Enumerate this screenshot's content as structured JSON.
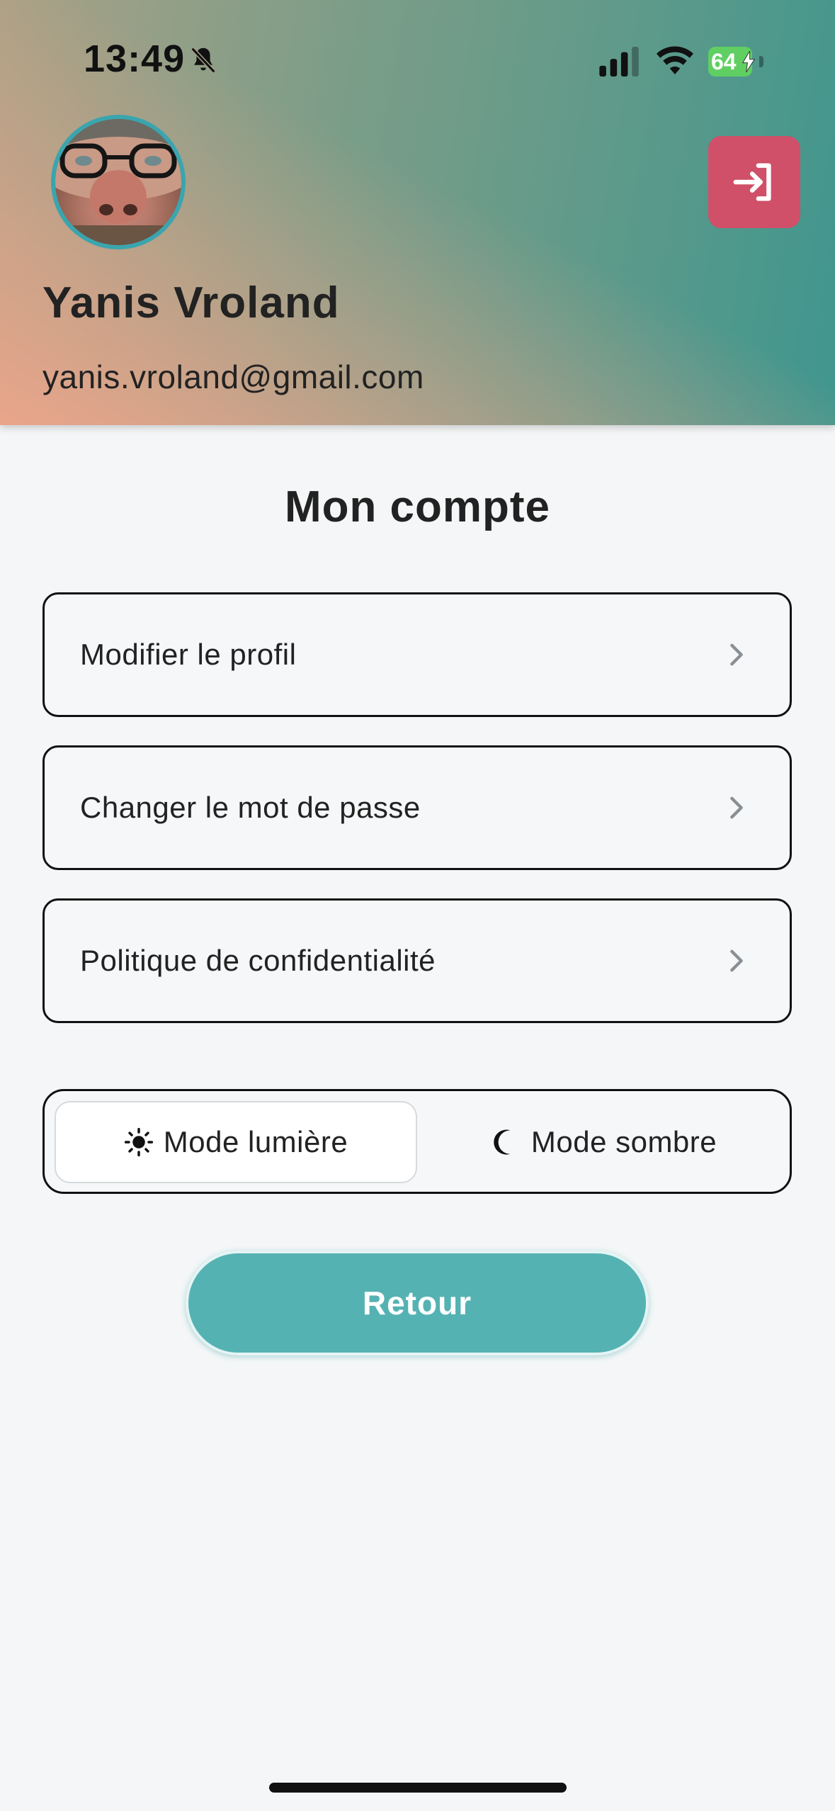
{
  "status_bar": {
    "time": "13:49",
    "battery_level": "64",
    "icons": [
      "bell-slash-icon",
      "cellular-signal-icon",
      "wifi-icon",
      "battery-charging-icon"
    ]
  },
  "profile": {
    "name": "Yanis Vroland",
    "email": "yanis.vroland@gmail.com",
    "logout_icon": "logout-icon",
    "logout_color": "#cf5068",
    "avatar_border_color": "#3aa5ae"
  },
  "page": {
    "title": "Mon compte"
  },
  "menu": {
    "items": [
      {
        "label": "Modifier le profil",
        "icon": "chevron-right-icon"
      },
      {
        "label": "Changer le mot de passe",
        "icon": "chevron-right-icon"
      },
      {
        "label": "Politique de confidentialité",
        "icon": "chevron-right-icon"
      }
    ]
  },
  "theme": {
    "options": [
      {
        "label": "Mode lumière",
        "icon": "sun-icon",
        "selected": true
      },
      {
        "label": "Mode sombre",
        "icon": "moon-icon",
        "selected": false
      }
    ]
  },
  "actions": {
    "back_label": "Retour",
    "back_color": "#55b2b3"
  }
}
